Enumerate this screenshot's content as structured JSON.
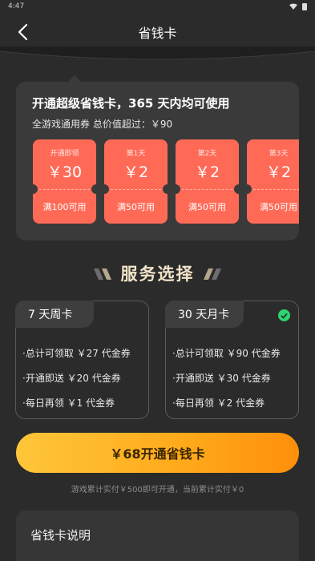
{
  "status_bar": {
    "time": "4:47"
  },
  "header": {
    "title": "省钱卡"
  },
  "card": {
    "heading": "开通超级省钱卡，365 天内均可使用",
    "subheading": "全游戏通用券 总价值超过：￥90",
    "coupons": [
      {
        "label": "开通即领",
        "amount": "￥30",
        "condition": "满100可用"
      },
      {
        "label": "第1天",
        "amount": "￥2",
        "condition": "满50可用"
      },
      {
        "label": "第2天",
        "amount": "￥2",
        "condition": "满50可用"
      },
      {
        "label": "第3天",
        "amount": "￥2",
        "condition": "满50可用"
      }
    ]
  },
  "service": {
    "title": "服务选择"
  },
  "plans": [
    {
      "name": "7 天周卡",
      "selected": false,
      "lines": [
        "·总计可领取 ￥27 代金券",
        "·开通即送 ￥20 代金券",
        "·每日再领 ￥1 代金券"
      ]
    },
    {
      "name": "30 天月卡",
      "selected": true,
      "lines": [
        "·总计可领取 ￥90 代金券",
        "·开通即送 ￥30 代金券",
        "·每日再领 ￥2 代金券"
      ]
    }
  ],
  "cta": {
    "label": "￥68开通省钱卡",
    "note": "游戏累计实付￥500即可开通，当前累计实付￥0"
  },
  "explain": {
    "title": "省钱卡说明"
  },
  "colors": {
    "coupon": "#ff6a57",
    "cta": "#ffb21f",
    "check": "#2fd36f",
    "service_title": "#f1e3c8"
  }
}
